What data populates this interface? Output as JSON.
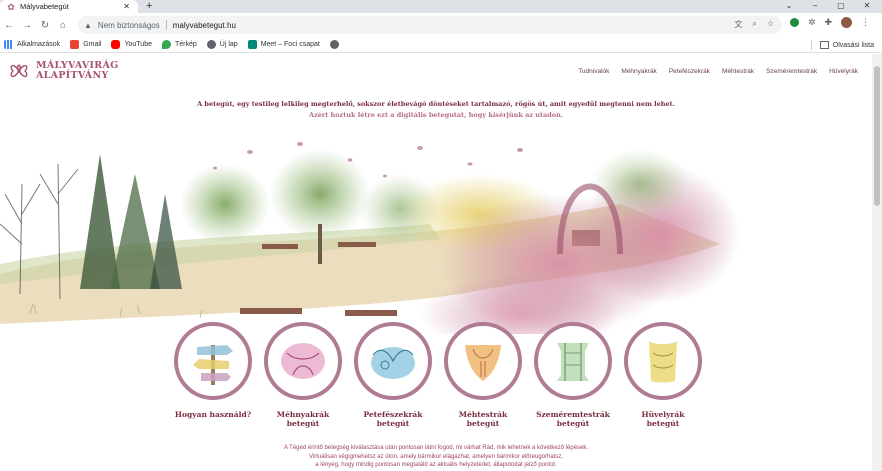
{
  "browser": {
    "tab_title": "Mályvabetegút",
    "new_tab": "+",
    "window_controls": {
      "minimize": "–",
      "maximize": "▢",
      "close": "✕"
    },
    "security_text": "Nem biztonságos",
    "url": "malyvabetegut.hu",
    "bookmarks": [
      {
        "label": "Alkalmazások",
        "color": "#4285f4"
      },
      {
        "label": "Gmail",
        "color": "#ea4335"
      },
      {
        "label": "YouTube",
        "color": "#ff0000"
      },
      {
        "label": "Térkép",
        "color": "#34a853"
      },
      {
        "label": "Új lap",
        "color": "#5f6368"
      },
      {
        "label": "Meet – Foci csapat",
        "color": "#00897b"
      }
    ],
    "reading_list": "Olvasási lista"
  },
  "site": {
    "logo_line1": "MÁLYVAVIRÁG",
    "logo_line2": "ALAPÍTVÁNY",
    "nav": [
      "Tudnivalók",
      "Méhnyakrák",
      "Petefészekrák",
      "Méhtestrák",
      "Szeméremtestrák",
      "Hüvelyrák"
    ],
    "intro_line1": "A betegút, egy testileg lelkileg megterhelő, sokszor életbevágó döntéseket tartalmazó, rögös út, amit egyedül megtenni nem lehet.",
    "intro_line2": "Azért hoztuk létre ezt a digitális betegutat, hogy kísérjünk az utadon.",
    "circles": [
      {
        "line1": "Hogyan használd?",
        "line2": "",
        "icon": "signpost-icon"
      },
      {
        "line1": "Méhnyakrák",
        "line2": "betegút",
        "icon": "cervix-icon"
      },
      {
        "line1": "Petefészekrák",
        "line2": "betegút",
        "icon": "ovary-icon"
      },
      {
        "line1": "Méhtestrák",
        "line2": "betegút",
        "icon": "uterus-icon"
      },
      {
        "line1": "Szeméremtestrák",
        "line2": "betegút",
        "icon": "vulva-icon"
      },
      {
        "line1": "Hüvelyrák",
        "line2": "betegút",
        "icon": "vagina-icon"
      }
    ],
    "footer_line1": "A Téged érintő betegség kiválasztása után pontosan látni fogod, mi várhat Rád, mik lehetnek a következő lépések.",
    "footer_line2": "Virtuálisan végigmehetsz az úton, amely bármikor elágazhat, amelyen bármikor előreugorhatsz,",
    "footer_line3": "a lényeg, hogy mindig pontosan megtaláld az aktuális helyzetedet, állapotodat jelző pontot.",
    "colors": {
      "brand": "#a65274",
      "dark": "#7a2b3b",
      "ring": "#b07c95"
    }
  }
}
